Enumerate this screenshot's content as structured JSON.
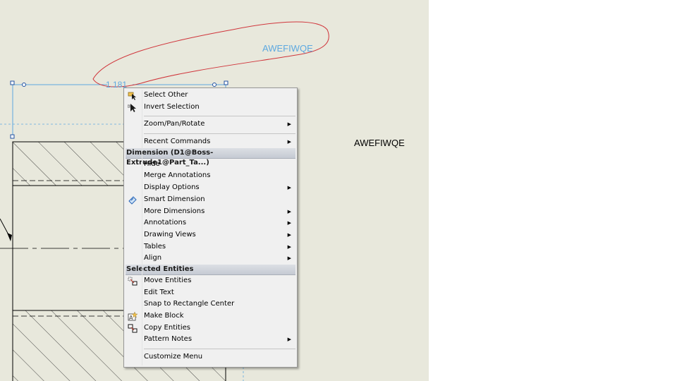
{
  "drawing": {
    "dimension_value": "1.181",
    "note_inside": "AWEFIWQE",
    "note_outside": "AWEFIWQE",
    "dimension_color": "#5ea9e0",
    "markup_color": "#d0353b",
    "background_color": "#e8e8dc"
  },
  "menu": {
    "group1": [
      {
        "label": "Select Other",
        "icon": "select-other-icon"
      },
      {
        "label": "Invert Selection",
        "icon": "invert-selection-icon"
      }
    ],
    "zoom": {
      "label": "Zoom/Pan/Rotate",
      "submenu": true
    },
    "recent": {
      "label": "Recent Commands",
      "submenu": true
    },
    "dimension_header": "Dimension (D1@Boss-Extrude1@Part_Ta...)",
    "dimension_items": [
      {
        "label": "Hide"
      },
      {
        "label": "Merge Annotations"
      },
      {
        "label": "Display Options",
        "submenu": true
      },
      {
        "label": "Smart Dimension",
        "icon": "smart-dimension-icon"
      },
      {
        "label": "More Dimensions",
        "submenu": true
      },
      {
        "label": "Annotations",
        "submenu": true
      },
      {
        "label": "Drawing Views",
        "submenu": true
      },
      {
        "label": "Tables",
        "submenu": true
      },
      {
        "label": "Align",
        "submenu": true
      }
    ],
    "entities_header": "Selected Entities",
    "entity_items": [
      {
        "label": "Move Entities",
        "icon": "move-entities-icon"
      },
      {
        "label": "Edit Text"
      },
      {
        "label": "Snap to Rectangle Center"
      },
      {
        "label": "Make Block",
        "icon": "make-block-icon"
      },
      {
        "label": "Copy Entities",
        "icon": "copy-entities-icon"
      },
      {
        "label": "Pattern Notes",
        "submenu": true
      }
    ],
    "customize": {
      "label": "Customize Menu"
    }
  }
}
